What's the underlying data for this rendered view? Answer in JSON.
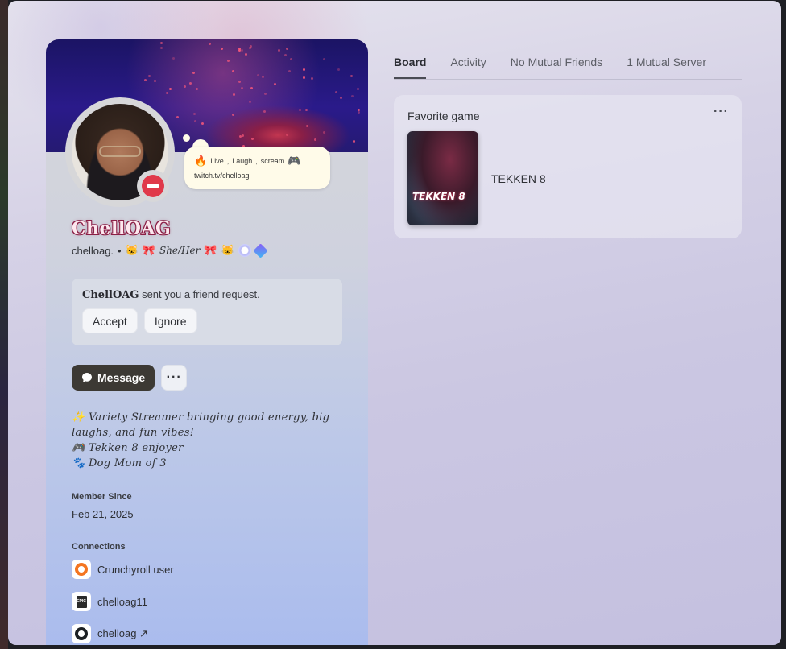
{
  "profile": {
    "status_bubble": {
      "line1": [
        "Live",
        ",",
        "Laugh",
        ",",
        "scream"
      ],
      "line2": "twitch.tv/chelloag"
    },
    "display_name": "ChellOAG",
    "username": "chelloag.",
    "separator": "•",
    "pronouns": "She/Her",
    "friend_request": {
      "name": "ChellOAG",
      "text": " sent you a friend request.",
      "accept_label": "Accept",
      "ignore_label": "Ignore"
    },
    "message_label": "Message",
    "more_label": "···",
    "bio": {
      "line1": "Variety Streamer bringing good energy, big laughs, and fun vibes!",
      "line2": "Tekken 8 enjoyer",
      "line3": "Dog Mom of 3"
    },
    "member_since_label": "Member Since",
    "member_since_value": "Feb 21, 2025",
    "connections_label": "Connections",
    "connections": [
      {
        "name": "Crunchyroll user",
        "icon": "crunchyroll-icon"
      },
      {
        "name": "chelloag11",
        "icon": "epic-games-icon"
      },
      {
        "name": "chelloag ↗",
        "icon": "github-icon"
      }
    ]
  },
  "tabs": [
    {
      "label": "Board",
      "active": true
    },
    {
      "label": "Activity",
      "active": false
    },
    {
      "label": "No Mutual Friends",
      "active": false
    },
    {
      "label": "1 Mutual Server",
      "active": false
    }
  ],
  "board": {
    "card_title": "Favorite game",
    "more_label": "···",
    "game_name": "TEKKEN 8",
    "cover_logo": "TEKKEN 8"
  },
  "colors": {
    "dnd_status": "#e0394a",
    "message_button": "#3c3934",
    "name_outline": "#8b1f46"
  }
}
